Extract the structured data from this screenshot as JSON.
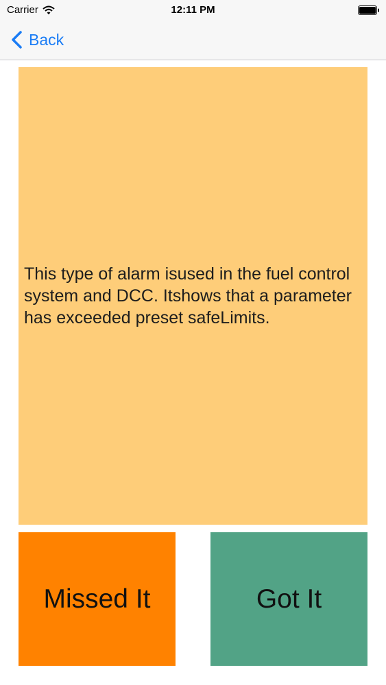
{
  "status_bar": {
    "carrier": "Carrier",
    "time": "12:11 PM",
    "wifi_icon": "wifi-icon",
    "battery_icon": "battery-icon"
  },
  "nav": {
    "back_label": "Back",
    "back_icon": "chevron-left-icon",
    "accent_color": "#1a7cf5"
  },
  "card": {
    "text": "This type of alarm isused in the fuel control system and DCC. Itshows that a parameter has exceeded preset safeLimits.",
    "color": "#fecd79"
  },
  "buttons": {
    "missed_label": "Missed It",
    "missed_color": "#ff8200",
    "got_label": "Got It",
    "got_color": "#52a386"
  }
}
